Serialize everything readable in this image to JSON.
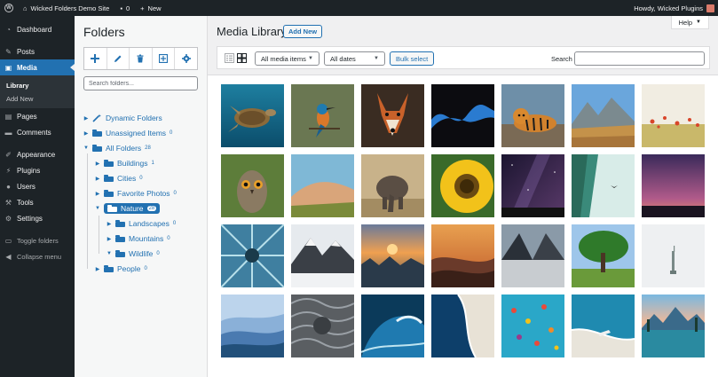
{
  "admin_bar": {
    "site_name": "Wicked Folders Demo Site",
    "comments_count": "0",
    "new_label": "New",
    "greeting": "Howdy, Wicked Plugins"
  },
  "sidebar": {
    "items": [
      {
        "label": "Dashboard",
        "icon": "dashboard-icon"
      },
      {
        "label": "Posts",
        "icon": "pin-icon"
      },
      {
        "label": "Media",
        "icon": "media-icon",
        "active": true
      },
      {
        "label": "Pages",
        "icon": "pages-icon"
      },
      {
        "label": "Comments",
        "icon": "comments-icon"
      },
      {
        "label": "Appearance",
        "icon": "brush-icon"
      },
      {
        "label": "Plugins",
        "icon": "plugin-icon"
      },
      {
        "label": "Users",
        "icon": "user-icon"
      },
      {
        "label": "Tools",
        "icon": "wrench-icon"
      },
      {
        "label": "Settings",
        "icon": "settings-icon"
      }
    ],
    "submenu": [
      "Library",
      "Add New"
    ],
    "toggle_folders": "Toggle folders",
    "collapse_menu": "Collapse menu"
  },
  "folders": {
    "title": "Folders",
    "search_placeholder": "Search folders...",
    "tree": [
      {
        "label": "Dynamic Folders",
        "count": ""
      },
      {
        "label": "Unassigned Items",
        "count": "0"
      },
      {
        "label": "All Folders",
        "count": "28"
      },
      {
        "label": "Buildings",
        "count": "1"
      },
      {
        "label": "Cities",
        "count": "0"
      },
      {
        "label": "Favorite Photos",
        "count": "0"
      },
      {
        "label": "Nature",
        "count": "28"
      },
      {
        "label": "Landscapes",
        "count": "0"
      },
      {
        "label": "Mountains",
        "count": "0"
      },
      {
        "label": "Wildlife",
        "count": "0"
      },
      {
        "label": "People",
        "count": "0"
      }
    ]
  },
  "main": {
    "title": "Media Library",
    "add_new": "Add New",
    "help": "Help",
    "filter_type": "All media items",
    "filter_date": "All dates",
    "bulk_select": "Bulk select",
    "search_label": "Search"
  },
  "media_items": [
    "sea-turtle",
    "kingfisher",
    "fox",
    "blue-river-aerial",
    "tiger",
    "mountain-valley",
    "wildflower-field",
    "owl",
    "desert-dunes",
    "elephant",
    "sunflower",
    "starry-sky",
    "teal-waterfall-bird",
    "purple-sunset",
    "blue-aerial-tree",
    "snowy-mountain",
    "cloud-sea-sunset",
    "misty-valley",
    "mountain-lake",
    "lone-tree",
    "statue-of-liberty",
    "blue-mountain-layers",
    "wavy-texture",
    "ocean-wave",
    "beach-aerial",
    "hot-air-balloons",
    "boat-on-beach",
    "mountain-lake-reflection"
  ]
}
